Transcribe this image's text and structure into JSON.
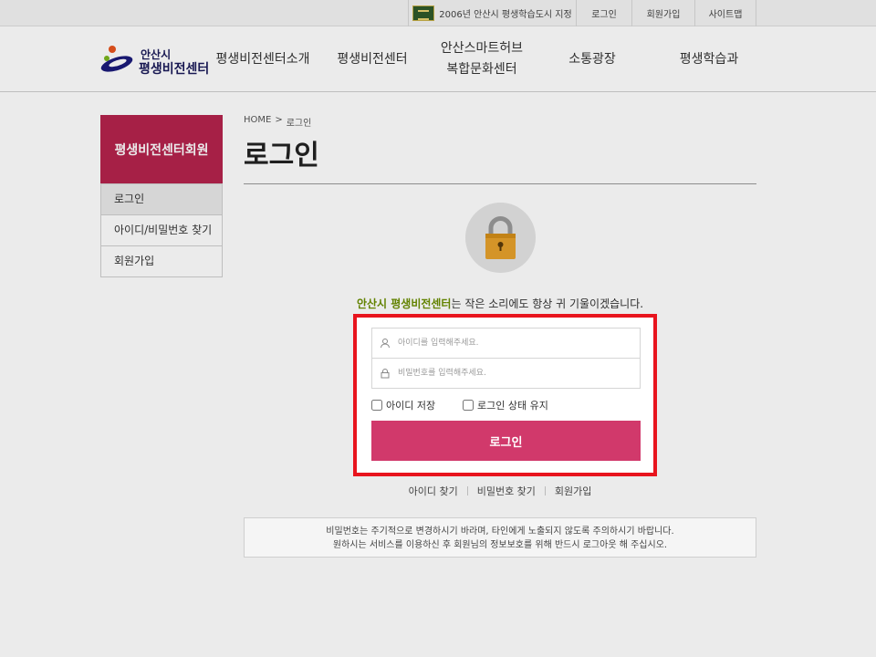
{
  "topbar": {
    "designation": "2006년 안산시 평생학습도시 지정",
    "login": "로그인",
    "join": "회원가입",
    "sitemap": "사이트맵"
  },
  "logo": {
    "city": "안산시",
    "name": "평생비전센터"
  },
  "gnb": [
    {
      "label": "평생비전센터소개"
    },
    {
      "label": "평생비전센터"
    },
    {
      "label_line1": "안산스마트허브",
      "label_line2": "복합문화센터"
    },
    {
      "label": "소통광장"
    },
    {
      "label": "평생학습과"
    }
  ],
  "lnb": {
    "title": "평생비전센터회원",
    "items": [
      {
        "label": "로그인",
        "active": true
      },
      {
        "label": "아이디/비밀번호 찾기",
        "active": false
      },
      {
        "label": "회원가입",
        "active": false
      }
    ]
  },
  "breadcrumb": {
    "home": "HOME",
    "sep": ">",
    "current": "로그인"
  },
  "page_title": "로그인",
  "tagline": {
    "highlight": "안산시 평생비전센터",
    "rest": "는 작은 소리에도 항상 귀 기울이겠습니다."
  },
  "form": {
    "id_placeholder": "아이디를 입력해주세요.",
    "pw_placeholder": "비밀번호를 입력해주세요.",
    "save_id_label": "아이디 저장",
    "keep_login_label": "로그인 상태 유지",
    "submit_label": "로그인"
  },
  "links": {
    "find_id": "아이디 찾기",
    "find_pw": "비밀번호 찾기",
    "join": "회원가입"
  },
  "notice": {
    "line1": "비밀번호는 주기적으로 변경하시기 바라며, 타인에게 노출되지 않도록 주의하시기 바랍니다.",
    "line2": "원하시는 서비스를 이용하신 후 회원님의 정보보호를 위해 반드시 로그아웃 해 주십시오."
  },
  "colors": {
    "brand": "#b5234d",
    "button": "#d1396b",
    "highlight_text": "#6b8e00",
    "focus_border": "#e8141e"
  },
  "icons": {
    "designation": "flag-badge-icon",
    "lock": "padlock-icon",
    "user": "user-icon",
    "password": "lock-icon"
  }
}
